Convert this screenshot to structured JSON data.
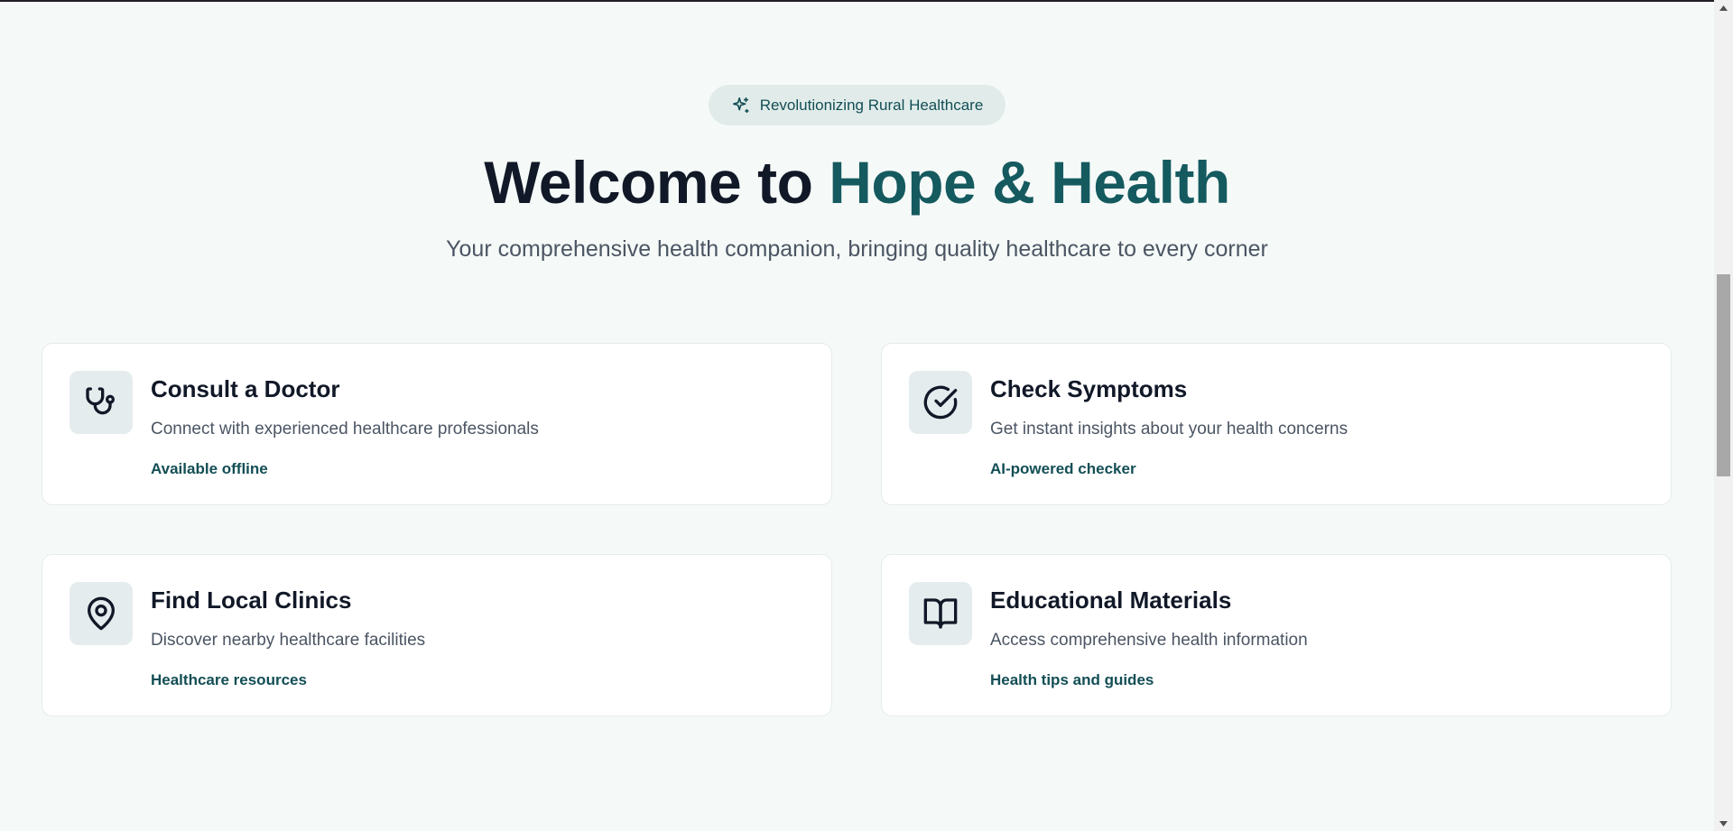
{
  "badge": {
    "icon": "sparkles-icon",
    "label": "Revolutionizing Rural Healthcare"
  },
  "hero": {
    "title_prefix": "Welcome to ",
    "title_accent": "Hope & Health",
    "subtitle": "Your comprehensive health companion, bringing quality healthcare to every corner"
  },
  "cards": [
    {
      "icon": "stethoscope-icon",
      "title": "Consult a Doctor",
      "description": "Connect with experienced healthcare professionals",
      "tag": "Available offline"
    },
    {
      "icon": "check-circle-icon",
      "title": "Check Symptoms",
      "description": "Get instant insights about your health concerns",
      "tag": "AI-powered checker"
    },
    {
      "icon": "map-pin-icon",
      "title": "Find Local Clinics",
      "description": "Discover nearby healthcare facilities",
      "tag": "Healthcare resources"
    },
    {
      "icon": "book-open-icon",
      "title": "Educational Materials",
      "description": "Access comprehensive health information",
      "tag": "Health tips and guides"
    }
  ],
  "colors": {
    "background": "#f5faf8",
    "accent": "#145a5f",
    "badge_bg": "#e1ecea",
    "icon_tile_bg": "#e5ecee"
  }
}
